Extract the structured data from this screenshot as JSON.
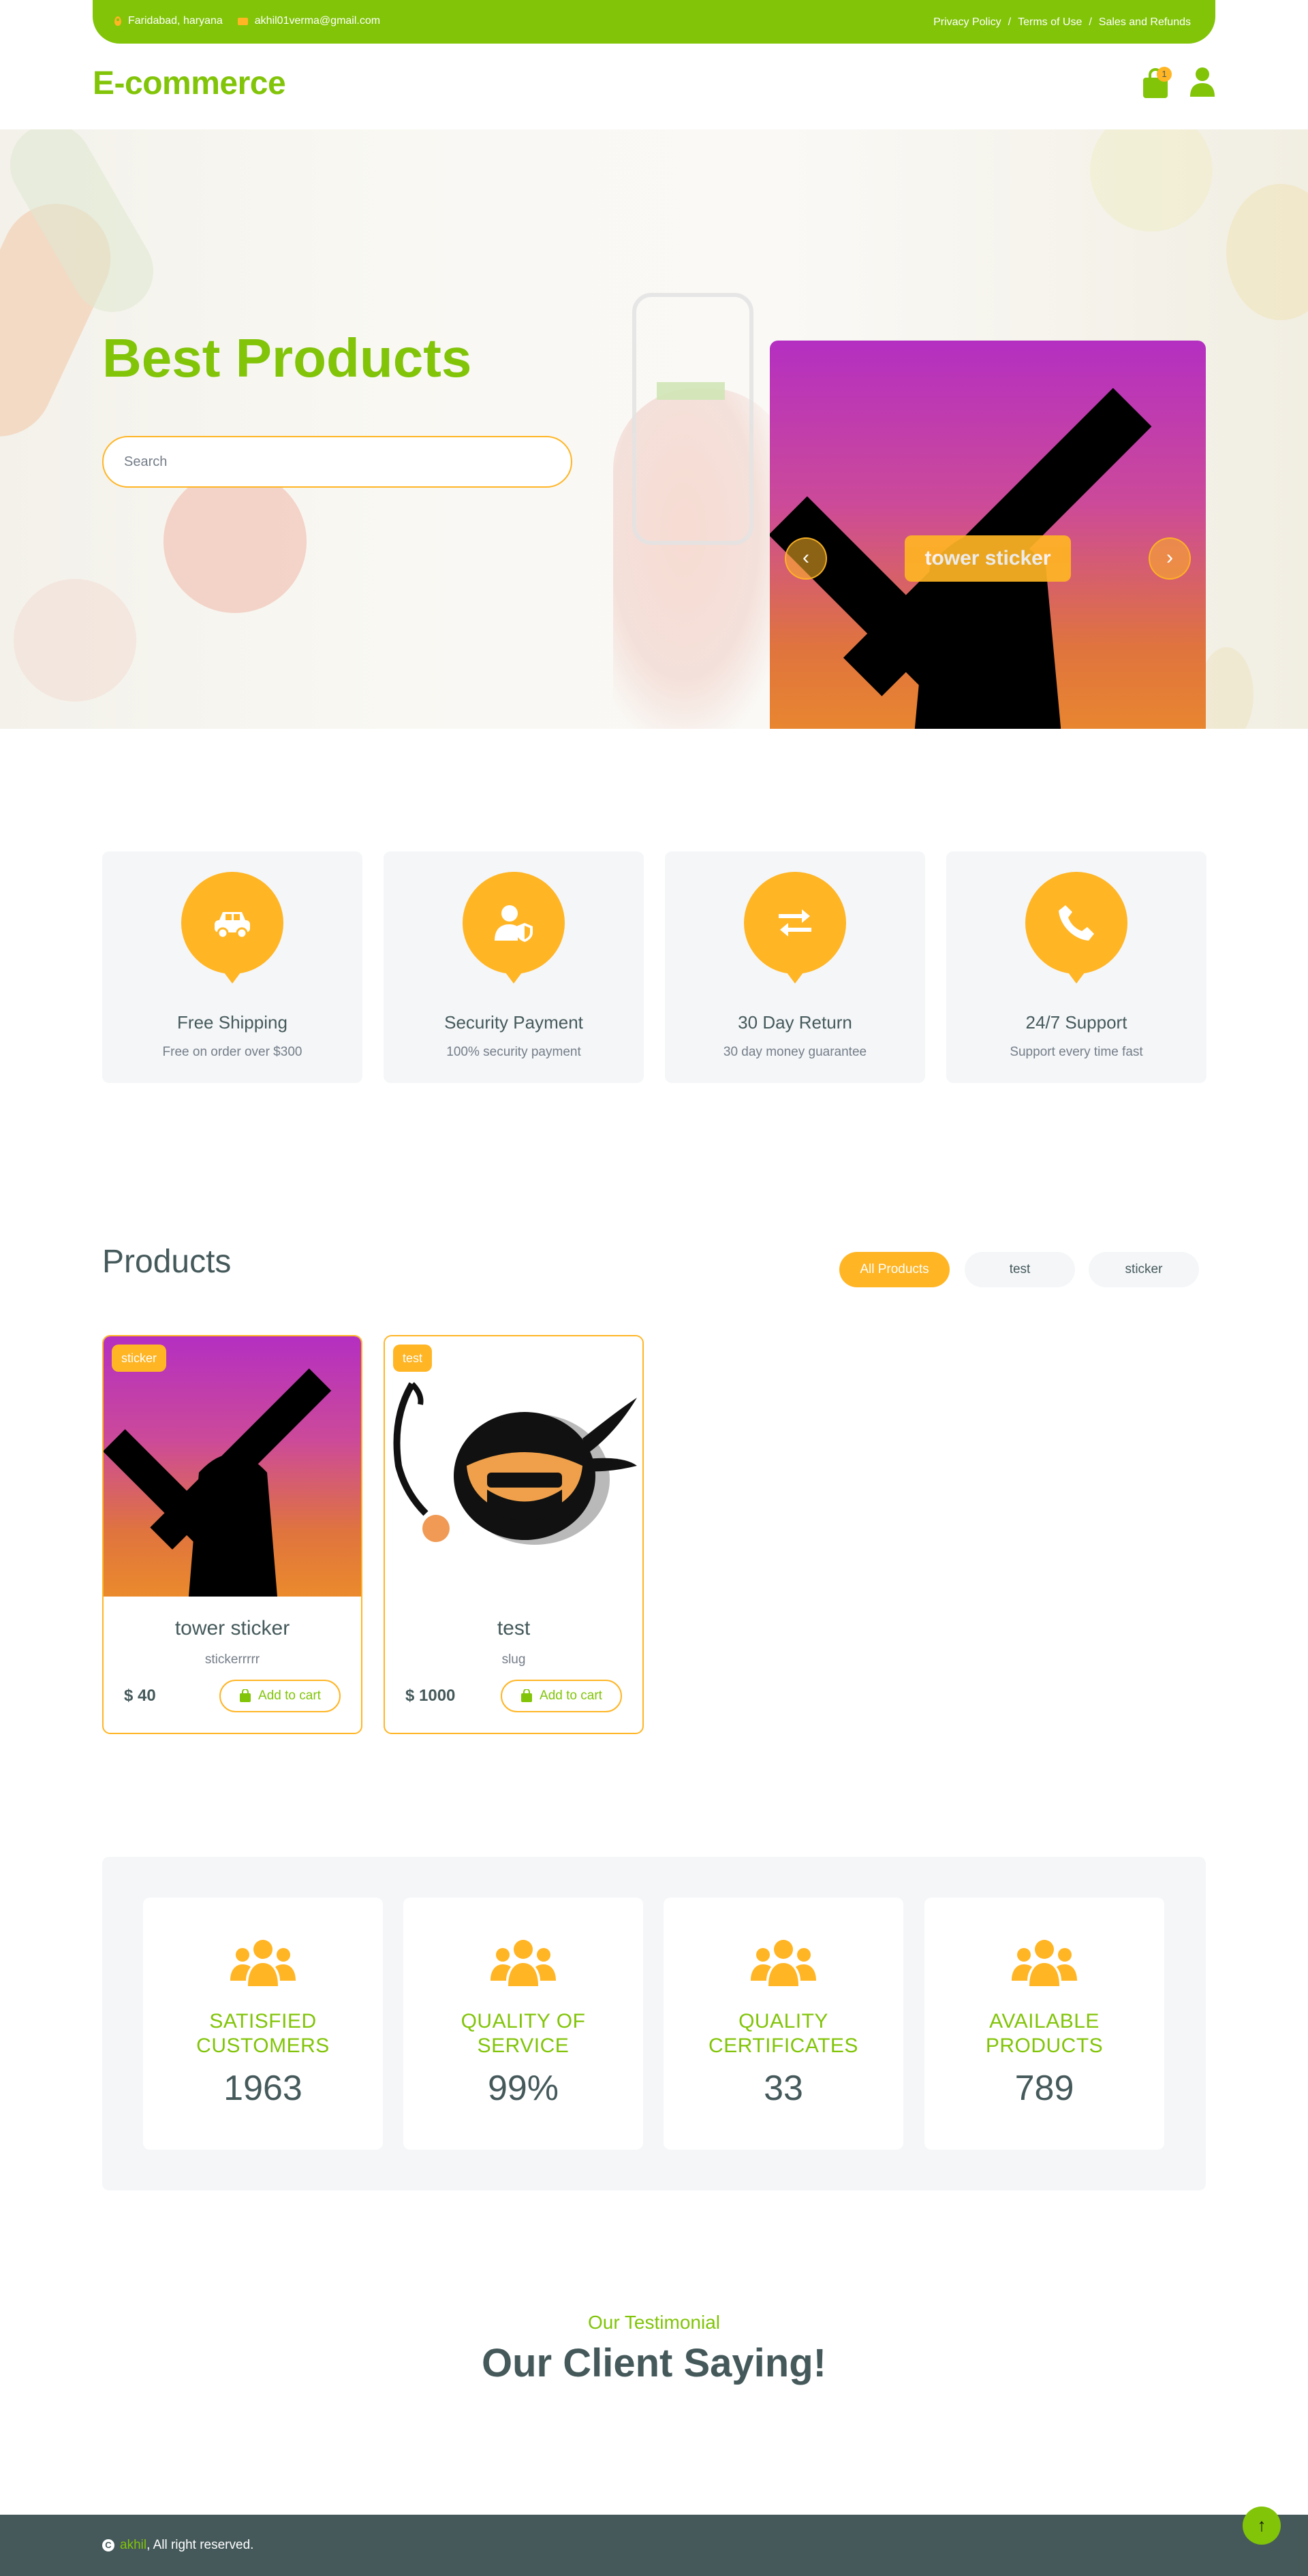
{
  "topbar": {
    "address": "Faridabad, haryana",
    "email": "akhil01verma@gmail.com",
    "links": [
      "Privacy Policy",
      "Terms of Use",
      "Sales and Refunds"
    ],
    "separator": "/"
  },
  "header": {
    "brand": "E-commerce",
    "cart_count": "1"
  },
  "hero": {
    "title": "Best Products",
    "search_placeholder": "Search",
    "carousel_label": "tower sticker",
    "prev_icon": "‹",
    "next_icon": "›"
  },
  "features": [
    {
      "icon": "car-icon",
      "title": "Free Shipping",
      "subtitle": "Free on order over $300"
    },
    {
      "icon": "user-shield-icon",
      "title": "Security Payment",
      "subtitle": "100% security payment"
    },
    {
      "icon": "exchange-icon",
      "title": "30 Day Return",
      "subtitle": "30 day money guarantee"
    },
    {
      "icon": "phone-icon",
      "title": "24/7 Support",
      "subtitle": "Support every time fast"
    }
  ],
  "products_section": {
    "heading": "Products",
    "filters": [
      "All Products",
      "test",
      "sticker"
    ],
    "active_filter": "All Products",
    "cart_label": "Add to cart",
    "items": [
      {
        "tag": "sticker",
        "name": "tower sticker",
        "slug": "stickerrrrr",
        "price": "$ 40"
      },
      {
        "tag": "test",
        "name": "test",
        "slug": "slug",
        "price": "$ 1000"
      }
    ]
  },
  "stats": [
    {
      "label_line1": "SATISFIED",
      "label_line2": "CUSTOMERS",
      "value": "1963"
    },
    {
      "label_line1": "QUALITY OF",
      "label_line2": "SERVICE",
      "value": "99%"
    },
    {
      "label_line1": "QUALITY",
      "label_line2": "CERTIFICATES",
      "value": "33"
    },
    {
      "label_line1": "AVAILABLE",
      "label_line2": "PRODUCTS",
      "value": "789"
    }
  ],
  "testimonial": {
    "subtitle": "Our Testimonial",
    "title": "Our Client Saying!"
  },
  "footer": {
    "copyright_symbol": "C",
    "name": "akhil",
    "rights": ", All right reserved.",
    "back_to_top": "↑"
  },
  "colors": {
    "primary": "#81c408",
    "accent": "#ffb524",
    "dark": "#45595b",
    "muted": "#747d88",
    "light_bg": "#f4f6f8"
  }
}
